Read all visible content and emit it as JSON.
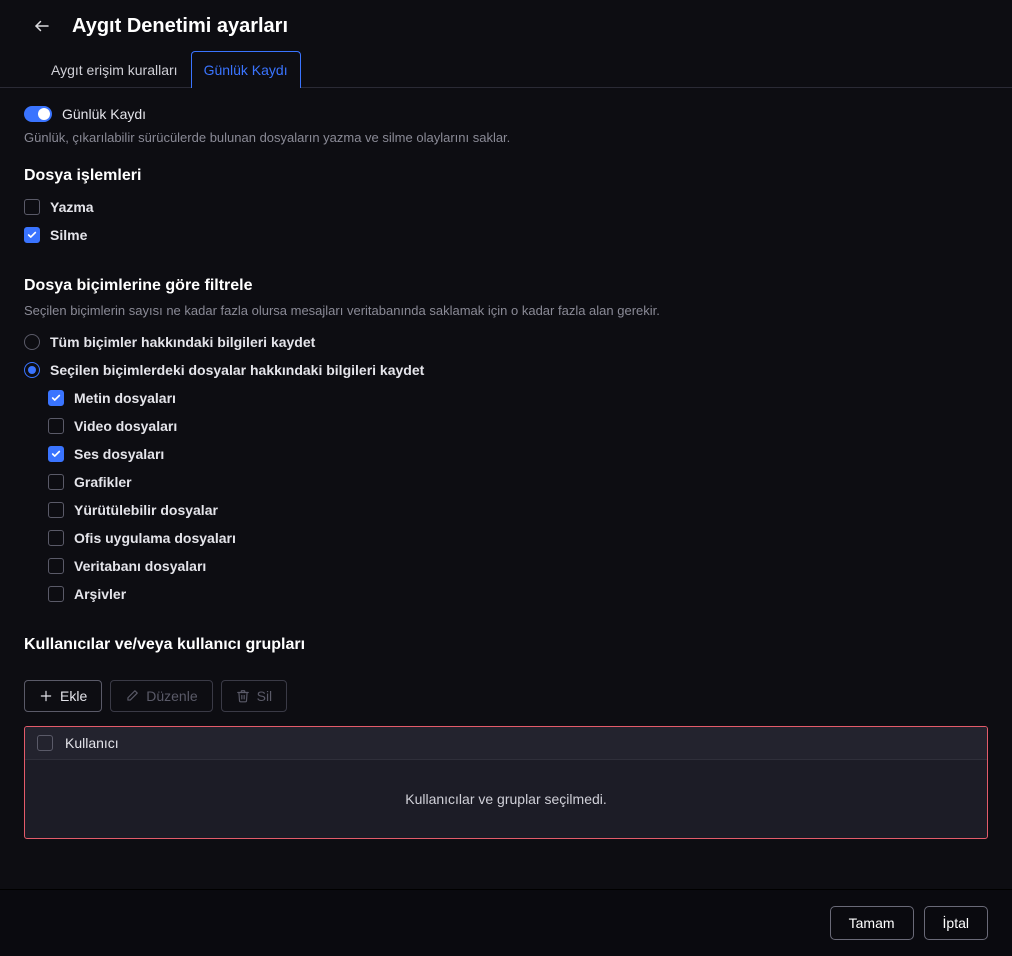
{
  "header": {
    "title": "Aygıt Denetimi ayarları"
  },
  "tabs": {
    "rules": "Aygıt erişim kuralları",
    "logging": "Günlük Kaydı"
  },
  "toggle": {
    "label": "Günlük Kaydı",
    "description": "Günlük, çıkarılabilir sürücülerde bulunan dosyaların yazma ve silme olaylarını saklar."
  },
  "sections": {
    "file_ops": "Dosya işlemleri",
    "filter": "Dosya biçimlerine göre filtrele",
    "filter_sub": "Seçilen biçimlerin sayısı ne kadar fazla olursa mesajları veritabanında saklamak için o kadar fazla alan gerekir.",
    "users": "Kullanıcılar ve/veya kullanıcı grupları"
  },
  "file_ops": {
    "write": "Yazma",
    "delete": "Silme"
  },
  "radios": {
    "all": "Tüm biçimler hakkındaki bilgileri kaydet",
    "selected": "Seçilen biçimlerdeki dosyalar hakkındaki bilgileri kaydet"
  },
  "formats": {
    "text": "Metin dosyaları",
    "video": "Video dosyaları",
    "audio": "Ses dosyaları",
    "graphics": "Grafikler",
    "exec": "Yürütülebilir dosyalar",
    "office": "Ofis uygulama dosyaları",
    "db": "Veritabanı dosyaları",
    "archive": "Arşivler"
  },
  "buttons": {
    "add": "Ekle",
    "edit": "Düzenle",
    "delete": "Sil"
  },
  "table": {
    "header": "Kullanıcı",
    "empty": "Kullanıcılar ve gruplar seçilmedi."
  },
  "footer": {
    "ok": "Tamam",
    "cancel": "İptal"
  }
}
